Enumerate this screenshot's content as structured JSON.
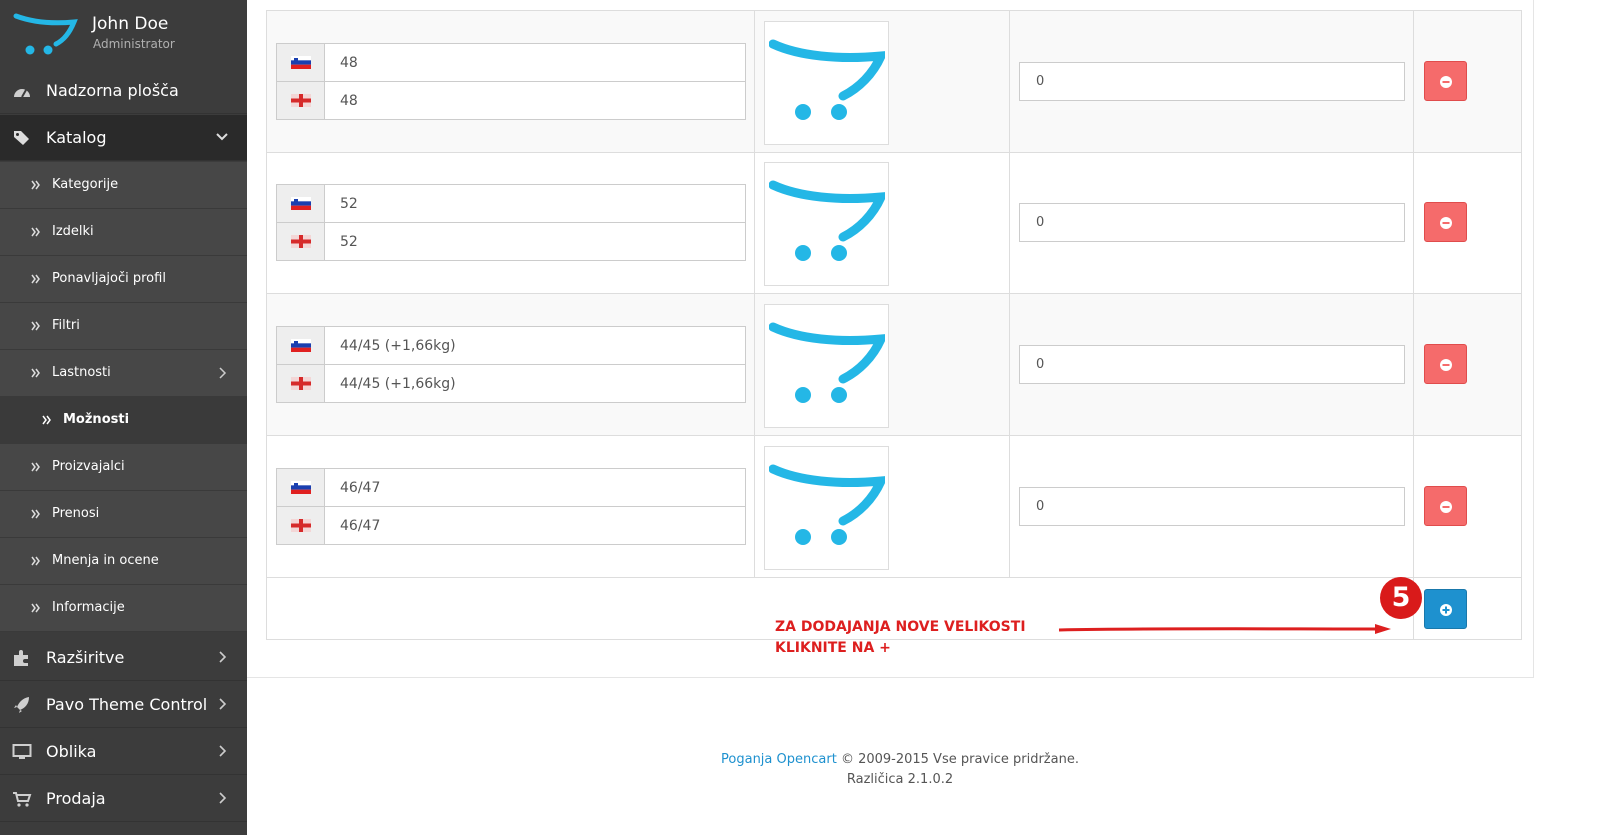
{
  "user": {
    "name": "John Doe",
    "role": "Administrator"
  },
  "sidebar": {
    "top_items": [
      {
        "label": "Nadzorna plošča",
        "icon": "dashboard-icon"
      },
      {
        "label": "Katalog",
        "icon": "tags-icon"
      }
    ],
    "catalog_items": [
      {
        "label": "Kategorije"
      },
      {
        "label": "Izdelki"
      },
      {
        "label": "Ponavljajoči profil"
      },
      {
        "label": "Filtri"
      },
      {
        "label": "Lastnosti"
      },
      {
        "label": "Možnosti"
      },
      {
        "label": "Proizvajalci"
      },
      {
        "label": "Prenosi"
      },
      {
        "label": "Mnenja in ocene"
      },
      {
        "label": "Informacije"
      }
    ],
    "bottom_items": [
      {
        "label": "Razširitve",
        "icon": "puzzle-icon"
      },
      {
        "label": "Pavo Theme Control",
        "icon": "rocket-icon"
      },
      {
        "label": "Oblika",
        "icon": "desktop-icon"
      },
      {
        "label": "Prodaja",
        "icon": "cart-icon"
      }
    ]
  },
  "option_values": [
    {
      "name_sl": "48",
      "name_en": "48",
      "sort": "0"
    },
    {
      "name_sl": "52",
      "name_en": "52",
      "sort": "0"
    },
    {
      "name_sl": "44/45 (+1,66kg)",
      "name_en": "44/45 (+1,66kg)",
      "sort": "0"
    },
    {
      "name_sl": "46/47",
      "name_en": "46/47",
      "sort": "0"
    }
  ],
  "annotation": {
    "step": "5",
    "line1": "ZA DODAJANJA NOVE VELIKOSTI",
    "line2": "KLIKNITE NA +"
  },
  "footer": {
    "link": "Poganja Opencart",
    "rights": "© 2009-2015 Vse pravice pridržane.",
    "version": "Različica 2.1.0.2"
  },
  "colors": {
    "sidebar_bg": "#3c3c3c",
    "danger": "#f56b6b",
    "primary": "#1e91cf",
    "opencart_logo": "#24b7e6",
    "annotation_red": "#dd1f1f"
  }
}
